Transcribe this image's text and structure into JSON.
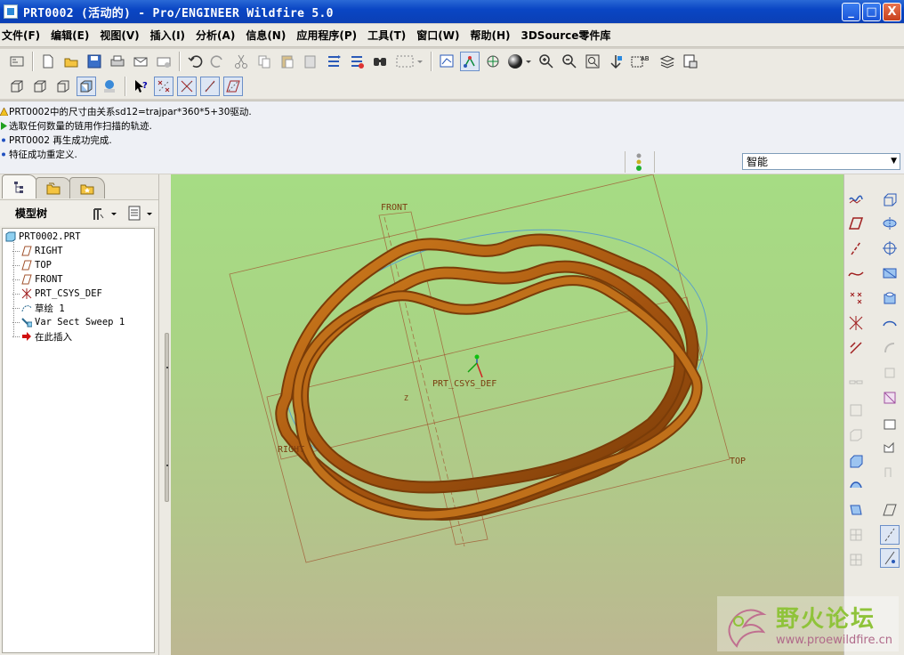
{
  "window": {
    "title": "PRT0002 (活动的) - Pro/ENGINEER Wildfire 5.0",
    "minimize": "_",
    "maximize": "□",
    "close": "X"
  },
  "menubar": [
    "文件(F)",
    "编辑(E)",
    "视图(V)",
    "插入(I)",
    "分析(A)",
    "信息(N)",
    "应用程序(P)",
    "工具(T)",
    "窗口(W)",
    "帮助(H)",
    "3DSource零件库"
  ],
  "toolbar1_icons": [
    "model-tree-settings-icon",
    "new-file-icon",
    "open-file-icon",
    "save-icon",
    "print-icon",
    "send-mail-icon",
    "mail-attach-icon",
    "undo-icon",
    "redo-icon",
    "cut-icon",
    "copy-icon",
    "paste-icon",
    "paste-special-icon",
    "regenerate-icon",
    "regenerate-manager-icon",
    "find-icon",
    "select-box-icon",
    "repaint-icon",
    "spin-center-icon",
    "orient-mode-icon",
    "appearance-icon",
    "zoom-in-icon",
    "zoom-out-icon",
    "refit-icon",
    "reorient-icon",
    "saved-views-icon",
    "layers-icon",
    "view-manager-icon"
  ],
  "toolbar2_icons": [
    "wireframe-icon",
    "hidden-line-icon",
    "no-hidden-icon",
    "shading-icon",
    "enhanced-realism-icon",
    "context-help-icon",
    "datum-points-display-icon",
    "datum-axes-display-icon",
    "coord-sys-display-icon",
    "datum-planes-display-icon"
  ],
  "messages": [
    {
      "icon": "warning",
      "text": "PRT0002中的尺寸由关系sd12=trajpar*360*5+30驱动."
    },
    {
      "icon": "prompt",
      "text": "选取任何数量的链用作扫描的轨迹."
    },
    {
      "icon": "info",
      "text": "PRT0002 再生成功完成."
    },
    {
      "icon": "info",
      "text": "特征成功重定义."
    }
  ],
  "filter": {
    "value": "智能"
  },
  "model_tree": {
    "header": "模型树",
    "nodes": [
      {
        "label": "PRT0002.PRT",
        "icon": "part-icon"
      },
      {
        "label": "RIGHT",
        "icon": "datum-plane-icon"
      },
      {
        "label": "TOP",
        "icon": "datum-plane-icon"
      },
      {
        "label": "FRONT",
        "icon": "datum-plane-icon"
      },
      {
        "label": "PRT_CSYS_DEF",
        "icon": "csys-icon"
      },
      {
        "label": "草绘 1",
        "icon": "sketch-icon"
      },
      {
        "label": "Var Sect Sweep 1",
        "icon": "sweep-icon"
      },
      {
        "label": "在此插入",
        "icon": "insert-arrow-icon"
      }
    ]
  },
  "viewport_labels": {
    "front": "FRONT",
    "right": "RIGHT",
    "top": "TOP",
    "csys": "PRT_CSYS_DEF",
    "axis_z": "Z"
  },
  "watermark": {
    "title": "野火论坛",
    "url": "www.proewildfire.cn"
  },
  "colors": {
    "model": "#b3620f",
    "datum": "#a0522d",
    "viewport_top": "#a6dc84",
    "viewport_bottom": "#bdb792"
  }
}
